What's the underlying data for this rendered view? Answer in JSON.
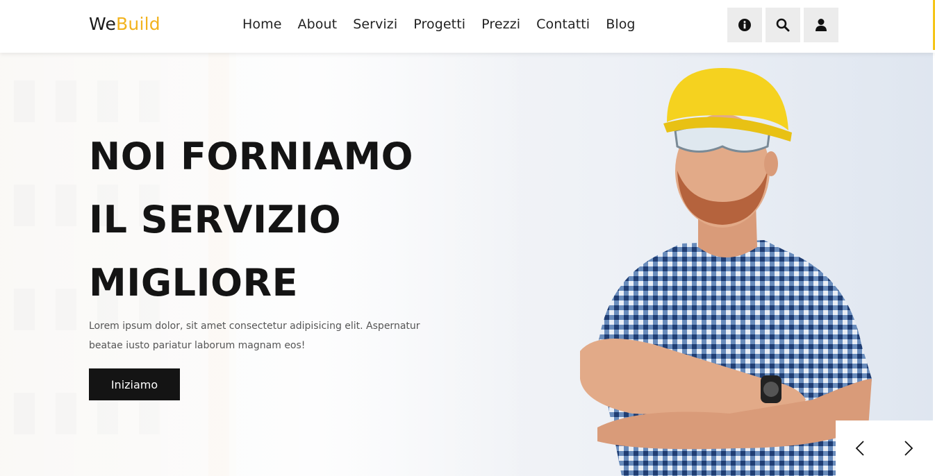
{
  "header": {
    "logo": {
      "part1": "We",
      "part2": "Build"
    },
    "nav": [
      "Home",
      "About",
      "Servizi",
      "Progetti",
      "Prezzi",
      "Contatti",
      "Blog"
    ],
    "icons": [
      "info-icon",
      "search-icon",
      "user-icon"
    ]
  },
  "hero": {
    "title_lines": [
      "NOI FORNIAMO",
      "IL SERVIZIO",
      "MIGLIORE"
    ],
    "text": "Lorem ipsum dolor, sit amet consectetur adipisicing elit. Aspernatur beatae iusto pariatur laborum magnam eos!",
    "cta_label": "Iniziamo"
  },
  "slider": {
    "prev_icon": "chevron-left-icon",
    "next_icon": "chevron-right-icon"
  },
  "colors": {
    "accent": "#f2b31d",
    "dark": "#141414",
    "helmet": "#f5d21f",
    "shirt": "#3f6aa8"
  }
}
